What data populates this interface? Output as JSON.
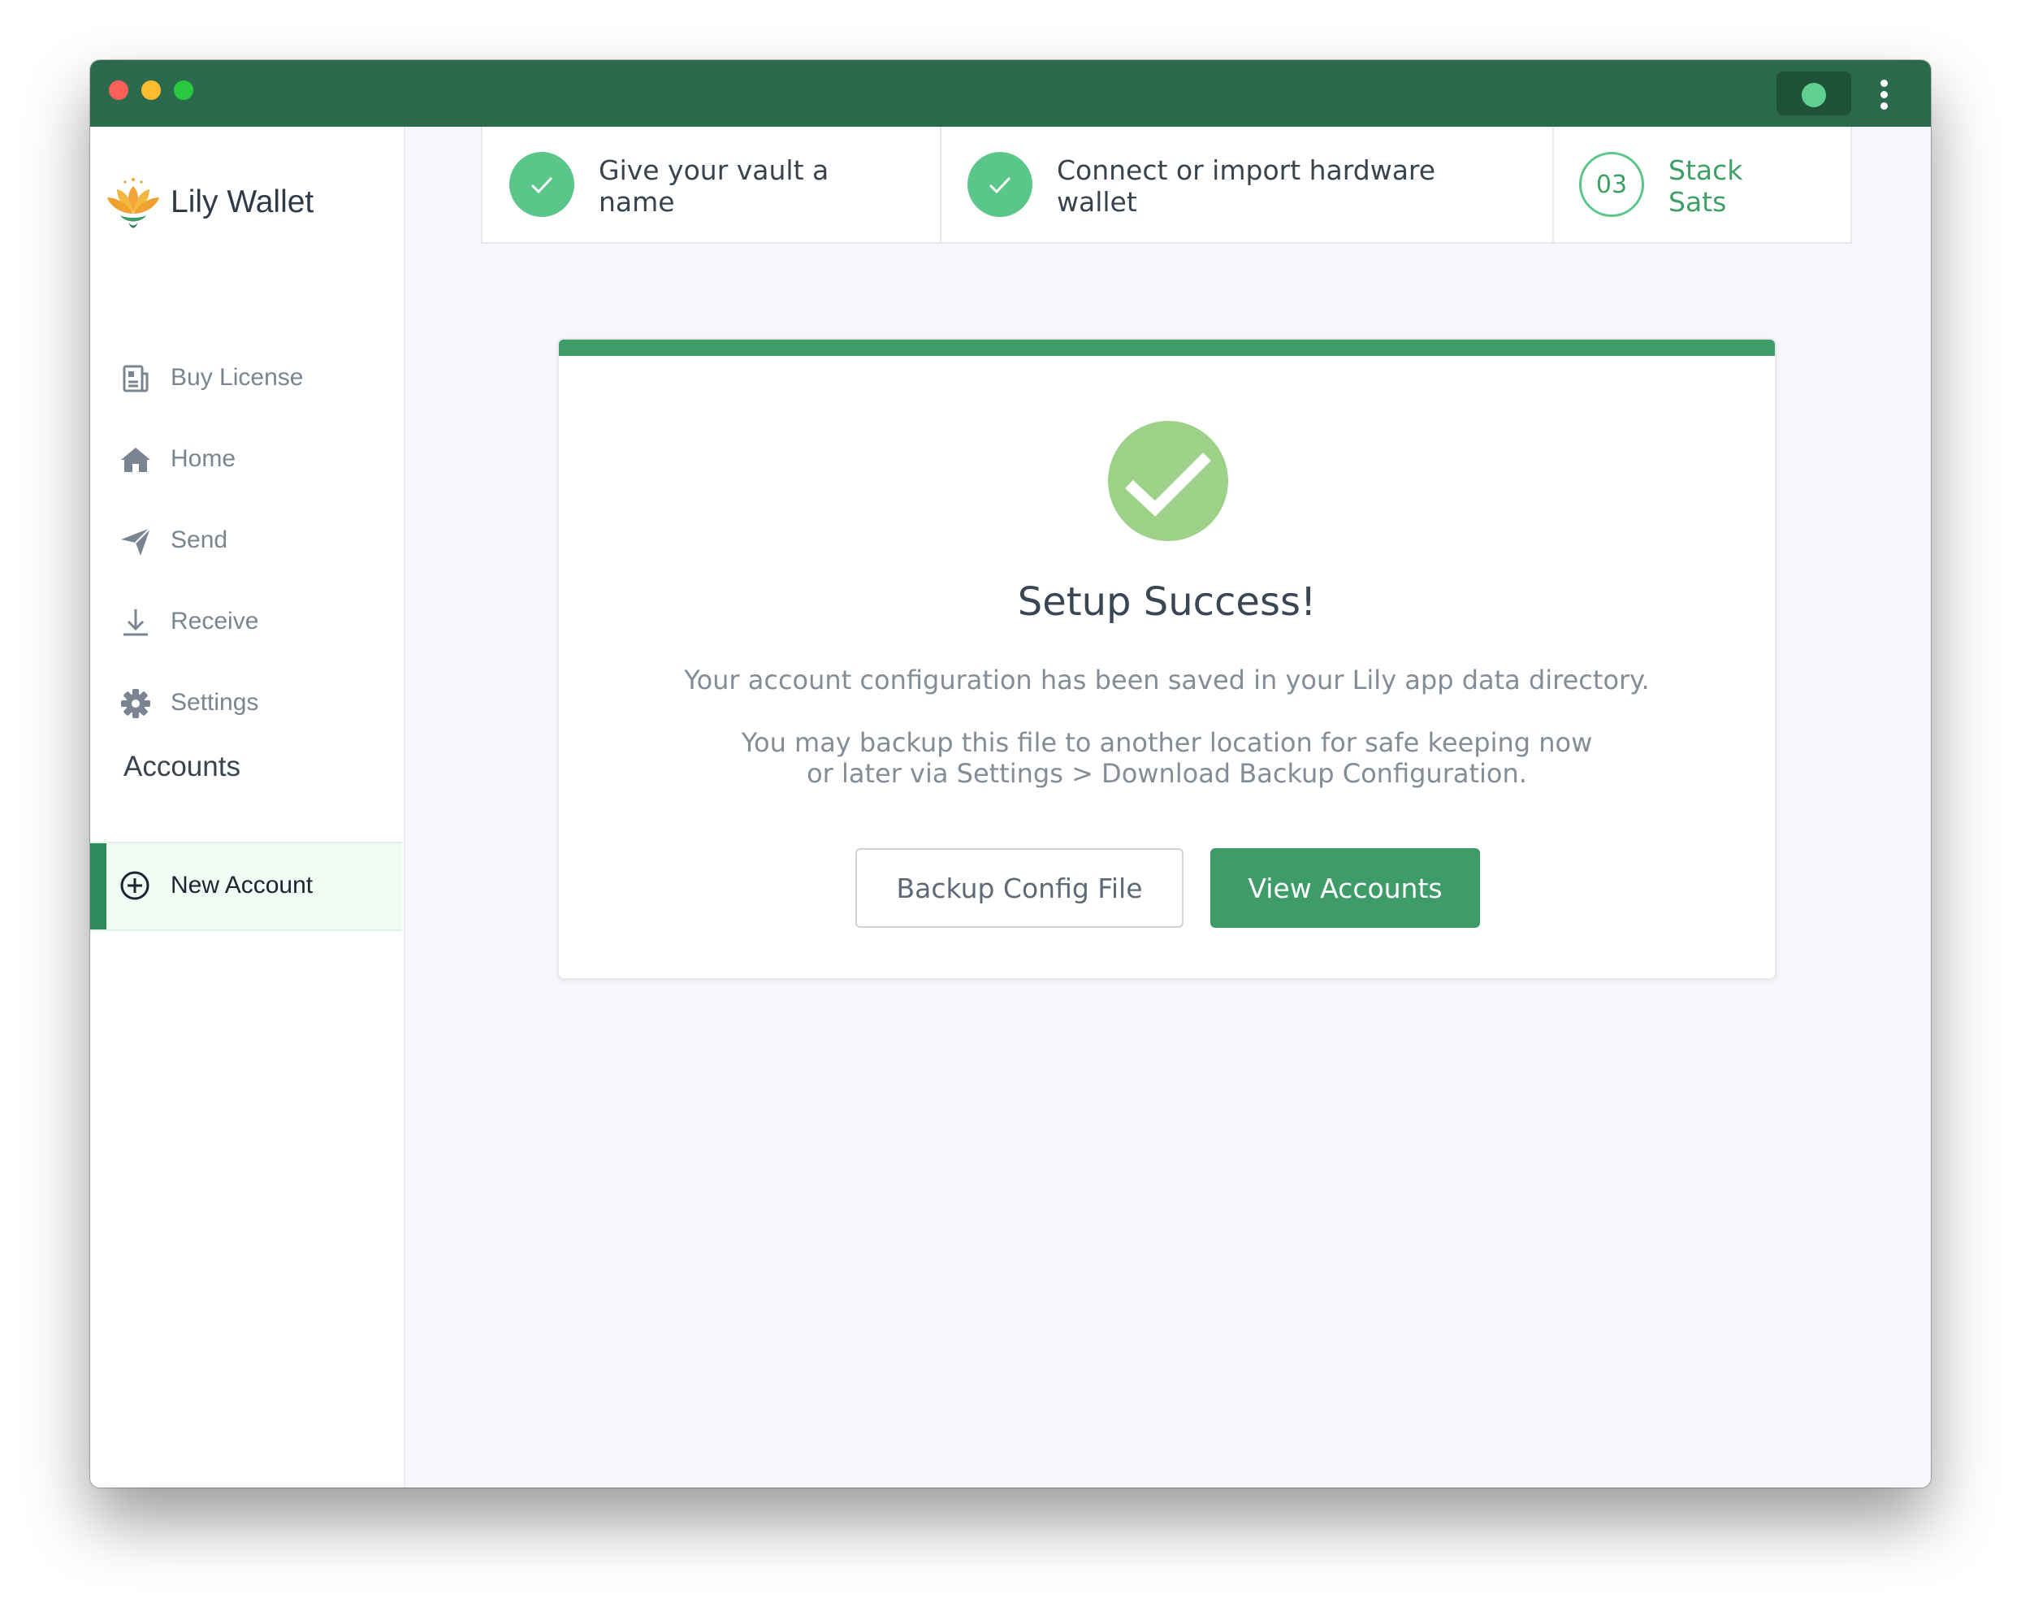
{
  "app": {
    "name": "Lily Wallet"
  },
  "sidebar": {
    "items": [
      {
        "label": "Buy License",
        "icon": "license-icon"
      },
      {
        "label": "Home",
        "icon": "home-icon"
      },
      {
        "label": "Send",
        "icon": "send-icon"
      },
      {
        "label": "Receive",
        "icon": "receive-icon"
      },
      {
        "label": "Settings",
        "icon": "gear-icon"
      }
    ],
    "accounts_title": "Accounts",
    "new_account_label": "New Account"
  },
  "steps": [
    {
      "label": "Give your vault a name",
      "status": "done"
    },
    {
      "label": "Connect or import hardware wallet",
      "status": "done"
    },
    {
      "number": "03",
      "label": "Stack Sats",
      "status": "current"
    }
  ],
  "card": {
    "title": "Setup Success!",
    "text1": "Your account configuration has been saved in your Lily app data directory.",
    "text2a": "You may backup this file to another location for safe keeping now",
    "text2b": "or later via Settings > Download Backup Configuration.",
    "backup_button": "Backup Config File",
    "view_button": "View Accounts"
  },
  "colors": {
    "brand": "#2b6a4d",
    "accent": "#3e9c68",
    "success": "#9dd187",
    "step_done": "#5bc68a"
  }
}
